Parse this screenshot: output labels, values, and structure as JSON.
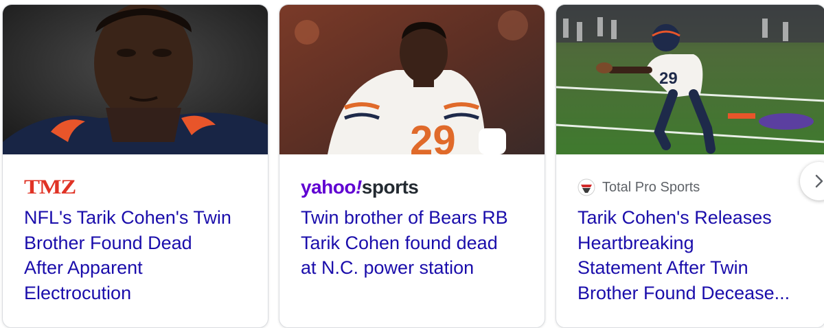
{
  "cards": [
    {
      "source": "TMZ",
      "headline_lines": [
        "NFL's Tarik Cohen's Twin",
        "Brother Found Dead",
        "After Apparent",
        "Electrocution"
      ],
      "image_icon": "football-player-helmetless-photo"
    },
    {
      "source": {
        "brand": "yahoo",
        "mark": "!",
        "section": "sports"
      },
      "headline_lines": [
        "Twin brother of Bears RB",
        "Tarik Cohen found dead",
        "at N.C. power station"
      ],
      "image_icon": "bears-player-jersey-photo"
    },
    {
      "source": "Total Pro Sports",
      "source_icon": "total-pro-sports-favicon",
      "headline_lines": [
        "Tarik Cohen's Releases",
        "Heartbreaking",
        "Statement After Twin",
        "Brother Found Decease..."
      ],
      "image_icon": "bears-player-29-running-photo"
    }
  ],
  "carousel": {
    "next_icon": "chevron-right-icon"
  },
  "colors": {
    "link": "#1a0dab",
    "tmz_red": "#e03325",
    "yahoo_purple": "#6001d2",
    "muted": "#5f6368"
  }
}
